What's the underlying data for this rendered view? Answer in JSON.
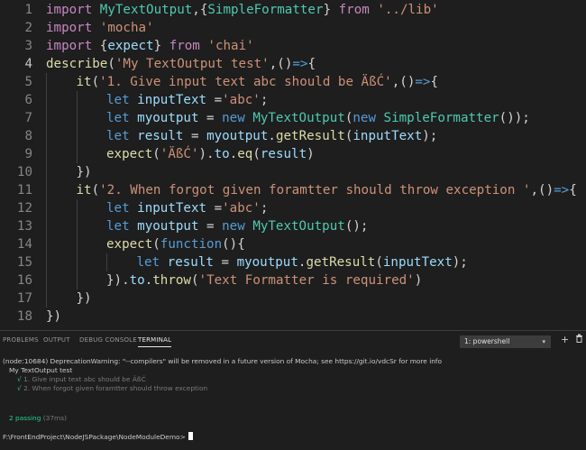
{
  "editor": {
    "active_line": 4,
    "lines": [
      {
        "n": "1",
        "indent": 0,
        "tokens": [
          [
            "kw",
            "import "
          ],
          [
            "ty",
            "MyTextOutput"
          ],
          [
            "pn",
            ",{"
          ],
          [
            "ty",
            "SimpleFormatter"
          ],
          [
            "pn",
            "} "
          ],
          [
            "kw",
            "from "
          ],
          [
            "st",
            "'../lib'"
          ]
        ]
      },
      {
        "n": "2",
        "indent": 0,
        "tokens": [
          [
            "kw",
            "import "
          ],
          [
            "st",
            "'mocha'"
          ]
        ]
      },
      {
        "n": "3",
        "indent": 0,
        "tokens": [
          [
            "kw",
            "import "
          ],
          [
            "pn",
            "{"
          ],
          [
            "vr",
            "expect"
          ],
          [
            "pn",
            "} "
          ],
          [
            "kw",
            "from "
          ],
          [
            "st",
            "'chai'"
          ]
        ]
      },
      {
        "n": "4",
        "indent": 0,
        "tokens": [
          [
            "fn",
            "describe"
          ],
          [
            "pn",
            "("
          ],
          [
            "st",
            "'My TextOutput test'"
          ],
          [
            "pn",
            ",()"
          ],
          [
            "bl",
            "=>"
          ],
          [
            "pn",
            "{"
          ]
        ]
      },
      {
        "n": "5",
        "indent": 1,
        "tokens": [
          [
            "fn",
            "it"
          ],
          [
            "pn",
            "("
          ],
          [
            "st",
            "'1. Give input text abc should be ÄßĆ'"
          ],
          [
            "pn",
            ",()"
          ],
          [
            "bl",
            "=>"
          ],
          [
            "pn",
            "{"
          ]
        ]
      },
      {
        "n": "6",
        "indent": 2,
        "tokens": [
          [
            "bl",
            "let "
          ],
          [
            "vr",
            "inputText "
          ],
          [
            "pn",
            "="
          ],
          [
            "st",
            "'abc'"
          ],
          [
            "pn",
            ";"
          ]
        ]
      },
      {
        "n": "7",
        "indent": 2,
        "tokens": [
          [
            "bl",
            "let "
          ],
          [
            "vr",
            "myoutput "
          ],
          [
            "pn",
            "= "
          ],
          [
            "bl",
            "new "
          ],
          [
            "ty",
            "MyTextOutput"
          ],
          [
            "pn",
            "("
          ],
          [
            "bl",
            "new "
          ],
          [
            "ty",
            "SimpleFormatter"
          ],
          [
            "pn",
            "());"
          ]
        ]
      },
      {
        "n": "8",
        "indent": 2,
        "tokens": [
          [
            "bl",
            "let "
          ],
          [
            "vr",
            "result "
          ],
          [
            "pn",
            "= "
          ],
          [
            "vr",
            "myoutput"
          ],
          [
            "pn",
            "."
          ],
          [
            "fn",
            "getResult"
          ],
          [
            "pn",
            "("
          ],
          [
            "vr",
            "inputText"
          ],
          [
            "pn",
            ");"
          ]
        ]
      },
      {
        "n": "9",
        "indent": 2,
        "tokens": [
          [
            "fn",
            "expect"
          ],
          [
            "pn",
            "("
          ],
          [
            "st",
            "'ÄßĆ'"
          ],
          [
            "pn",
            ")."
          ],
          [
            "vr",
            "to"
          ],
          [
            "pn",
            "."
          ],
          [
            "fn",
            "eq"
          ],
          [
            "pn",
            "("
          ],
          [
            "vr",
            "result"
          ],
          [
            "pn",
            ")"
          ]
        ]
      },
      {
        "n": "10",
        "indent": 1,
        "tokens": [
          [
            "pn",
            "})"
          ]
        ]
      },
      {
        "n": "11",
        "indent": 1,
        "tokens": [
          [
            "fn",
            "it"
          ],
          [
            "pn",
            "("
          ],
          [
            "st",
            "'2. When forgot given foramtter should throw exception '"
          ],
          [
            "pn",
            ",()"
          ],
          [
            "bl",
            "=>"
          ],
          [
            "pn",
            "{"
          ]
        ]
      },
      {
        "n": "12",
        "indent": 2,
        "tokens": [
          [
            "bl",
            "let "
          ],
          [
            "vr",
            "inputText "
          ],
          [
            "pn",
            "="
          ],
          [
            "st",
            "'abc'"
          ],
          [
            "pn",
            ";"
          ]
        ]
      },
      {
        "n": "13",
        "indent": 2,
        "tokens": [
          [
            "bl",
            "let "
          ],
          [
            "vr",
            "myoutput "
          ],
          [
            "pn",
            "= "
          ],
          [
            "bl",
            "new "
          ],
          [
            "ty",
            "MyTextOutput"
          ],
          [
            "pn",
            "();"
          ]
        ]
      },
      {
        "n": "14",
        "indent": 2,
        "tokens": [
          [
            "fn",
            "expect"
          ],
          [
            "pn",
            "("
          ],
          [
            "bl",
            "function"
          ],
          [
            "pn",
            "(){"
          ]
        ]
      },
      {
        "n": "15",
        "indent": 3,
        "tokens": [
          [
            "bl",
            "let "
          ],
          [
            "vr",
            "result "
          ],
          [
            "pn",
            "= "
          ],
          [
            "vr",
            "myoutput"
          ],
          [
            "pn",
            "."
          ],
          [
            "fn",
            "getResult"
          ],
          [
            "pn",
            "("
          ],
          [
            "vr",
            "inputText"
          ],
          [
            "pn",
            ");"
          ]
        ]
      },
      {
        "n": "16",
        "indent": 2,
        "tokens": [
          [
            "pn",
            "})."
          ],
          [
            "vr",
            "to"
          ],
          [
            "pn",
            "."
          ],
          [
            "fn",
            "throw"
          ],
          [
            "pn",
            "("
          ],
          [
            "st",
            "'Text Formatter is required'"
          ],
          [
            "pn",
            ")"
          ]
        ]
      },
      {
        "n": "17",
        "indent": 1,
        "tokens": [
          [
            "pn",
            "})"
          ]
        ]
      },
      {
        "n": "18",
        "indent": 0,
        "tokens": [
          [
            "pn",
            "})"
          ]
        ]
      }
    ]
  },
  "panel": {
    "tabs": [
      "PROBLEMS",
      "OUTPUT",
      "DEBUG CONSOLE",
      "TERMINAL"
    ],
    "active_tab": "TERMINAL",
    "terminal_select": "1: powershell",
    "icons": [
      "plus-icon",
      "trash-icon",
      "chevron-up-icon",
      "close-icon"
    ]
  },
  "terminal": {
    "warning": "(node:10684) DeprecationWarning: \"--compilers\" will be removed in a future version of Mocha; see https://git.io/vdcSr for more info",
    "suite": "My TextOutput test",
    "tests": [
      {
        "check": "√",
        "label": "1. Give input text abc should be ÄßĆ"
      },
      {
        "check": "√",
        "label": "2. When forgot given foramtter should throw exception"
      }
    ],
    "passing": "2 passing",
    "duration": "(37ms)",
    "prompt": "F:\\FrontEndProject\\NodeJSPackage\\NodeModuleDemo>"
  }
}
